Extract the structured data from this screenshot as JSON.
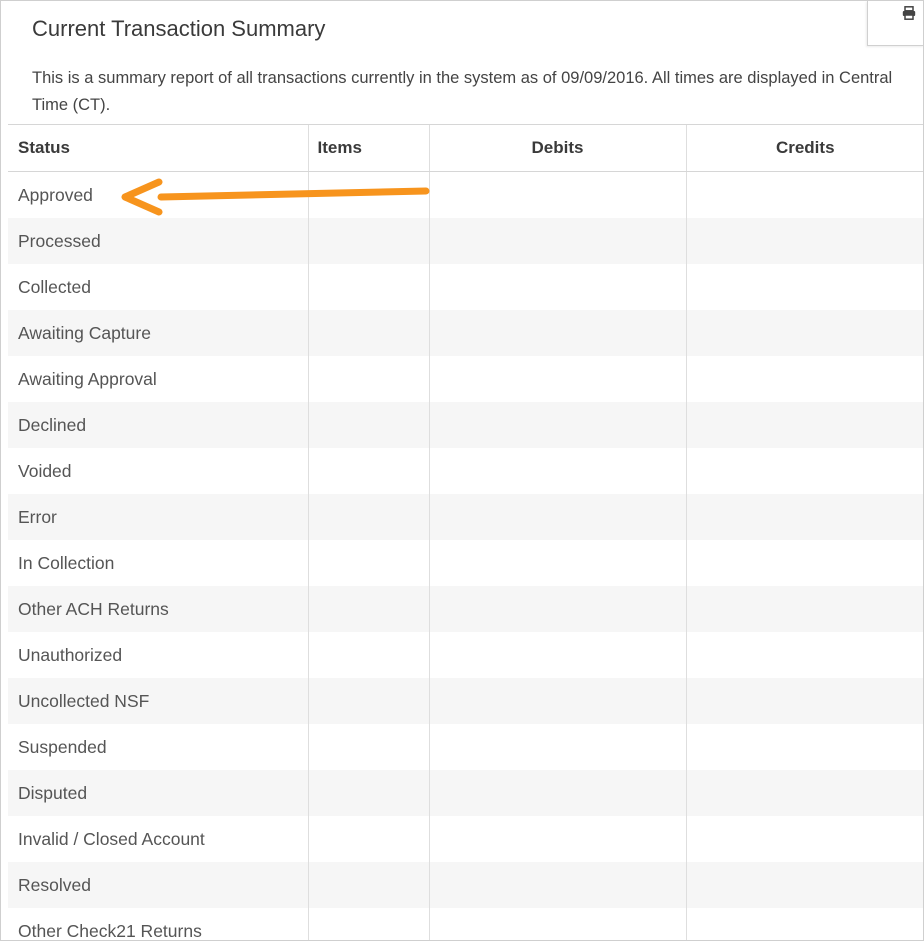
{
  "panel": {
    "title": "Current Transaction Summary",
    "description": "This is a summary report of all transactions currently in the system as of 09/09/2016. All times are displayed in Central Time (CT).",
    "print_icon": "printer-icon"
  },
  "table": {
    "headers": {
      "status": "Status",
      "items": "Items",
      "debits": "Debits",
      "credits": "Credits"
    },
    "rows": [
      {
        "status": "Approved",
        "items": "",
        "debits": "",
        "credits": ""
      },
      {
        "status": "Processed",
        "items": "",
        "debits": "",
        "credits": ""
      },
      {
        "status": "Collected",
        "items": "",
        "debits": "",
        "credits": ""
      },
      {
        "status": "Awaiting Capture",
        "items": "",
        "debits": "",
        "credits": ""
      },
      {
        "status": "Awaiting Approval",
        "items": "",
        "debits": "",
        "credits": ""
      },
      {
        "status": "Declined",
        "items": "",
        "debits": "",
        "credits": ""
      },
      {
        "status": "Voided",
        "items": "",
        "debits": "",
        "credits": ""
      },
      {
        "status": "Error",
        "items": "",
        "debits": "",
        "credits": ""
      },
      {
        "status": "In Collection",
        "items": "",
        "debits": "",
        "credits": ""
      },
      {
        "status": "Other ACH Returns",
        "items": "",
        "debits": "",
        "credits": ""
      },
      {
        "status": "Unauthorized",
        "items": "",
        "debits": "",
        "credits": ""
      },
      {
        "status": "Uncollected NSF",
        "items": "",
        "debits": "",
        "credits": ""
      },
      {
        "status": "Suspended",
        "items": "",
        "debits": "",
        "credits": ""
      },
      {
        "status": "Disputed",
        "items": "",
        "debits": "",
        "credits": ""
      },
      {
        "status": "Invalid / Closed Account",
        "items": "",
        "debits": "",
        "credits": ""
      },
      {
        "status": "Resolved",
        "items": "",
        "debits": "",
        "credits": ""
      },
      {
        "status": "Other Check21 Returns",
        "items": "",
        "debits": "",
        "credits": ""
      }
    ]
  },
  "annotation": {
    "arrow_icon": "arrow-left-icon",
    "color": "#f7941d"
  }
}
